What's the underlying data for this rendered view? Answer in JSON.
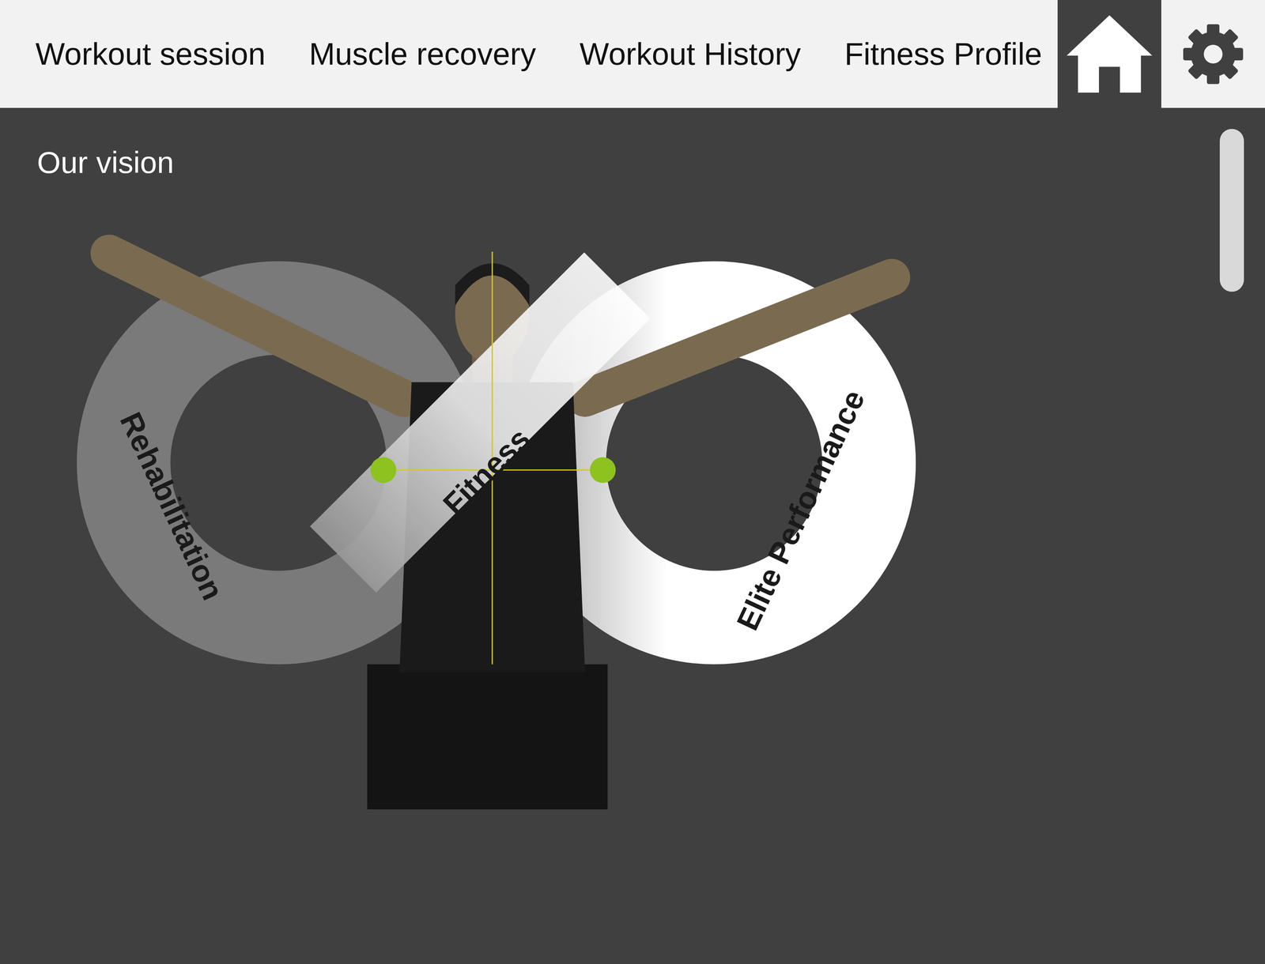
{
  "nav": {
    "items": [
      {
        "label": "Workout session",
        "selected": false
      },
      {
        "label": "Muscle recovery",
        "selected": false
      },
      {
        "label": "Workout History",
        "selected": false
      },
      {
        "label": "Fitness Profile",
        "selected": false
      }
    ],
    "home": {
      "selected": true
    },
    "settings": {
      "selected": false
    }
  },
  "page": {
    "title": "Our vision"
  },
  "vision": {
    "labels": {
      "left": "Rehabilitation",
      "center": "Fitness",
      "right": "Elite Performance"
    }
  },
  "scrollbar": {
    "level": 0.2
  }
}
